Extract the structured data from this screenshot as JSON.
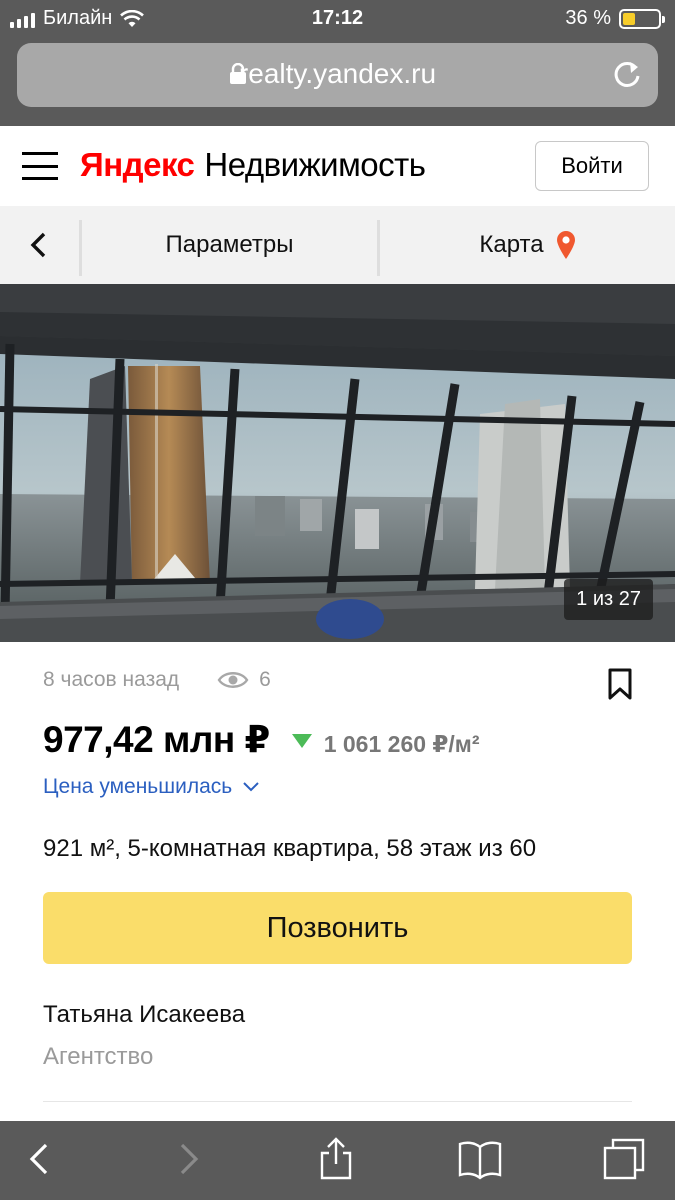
{
  "status_bar": {
    "carrier": "Билайн",
    "time": "17:12",
    "battery": "36 %",
    "battery_level": 0.36
  },
  "browser": {
    "url": "realty.yandex.ru",
    "lock_icon": "lock-icon",
    "reload_icon": "reload-icon"
  },
  "header": {
    "logo_brand": "Яндекс",
    "logo_service": "Недвижимость",
    "login_label": "Войти",
    "menu_icon": "hamburger-icon"
  },
  "subnav": {
    "back_icon": "chevron-left-icon",
    "params_label": "Параметры",
    "map_label": "Карта",
    "map_icon": "map-pin-icon"
  },
  "gallery": {
    "counter": "1 из 27"
  },
  "listing": {
    "posted": "8 часов назад",
    "views": "6",
    "price": "977,42 млн ₽",
    "price_per_m2": "1 061 260 ₽/м²",
    "price_change": "Цена уменьшилась",
    "description": "921 м², 5-комнатная квартира, 58 этаж из 60",
    "call_label": "Позвонить",
    "agent_name": "Татьяна Исакеева",
    "agent_type": "Агентство"
  },
  "colors": {
    "call_button": "#fadd6a",
    "price_down": "#4cbb58",
    "link": "#2b5fc0",
    "logo_red": "#ff0000"
  },
  "toolbar": {
    "back_icon": "chevron-left-icon",
    "forward_icon": "chevron-right-icon",
    "share_icon": "share-icon",
    "bookmarks_icon": "book-icon",
    "tabs_icon": "tabs-icon"
  }
}
